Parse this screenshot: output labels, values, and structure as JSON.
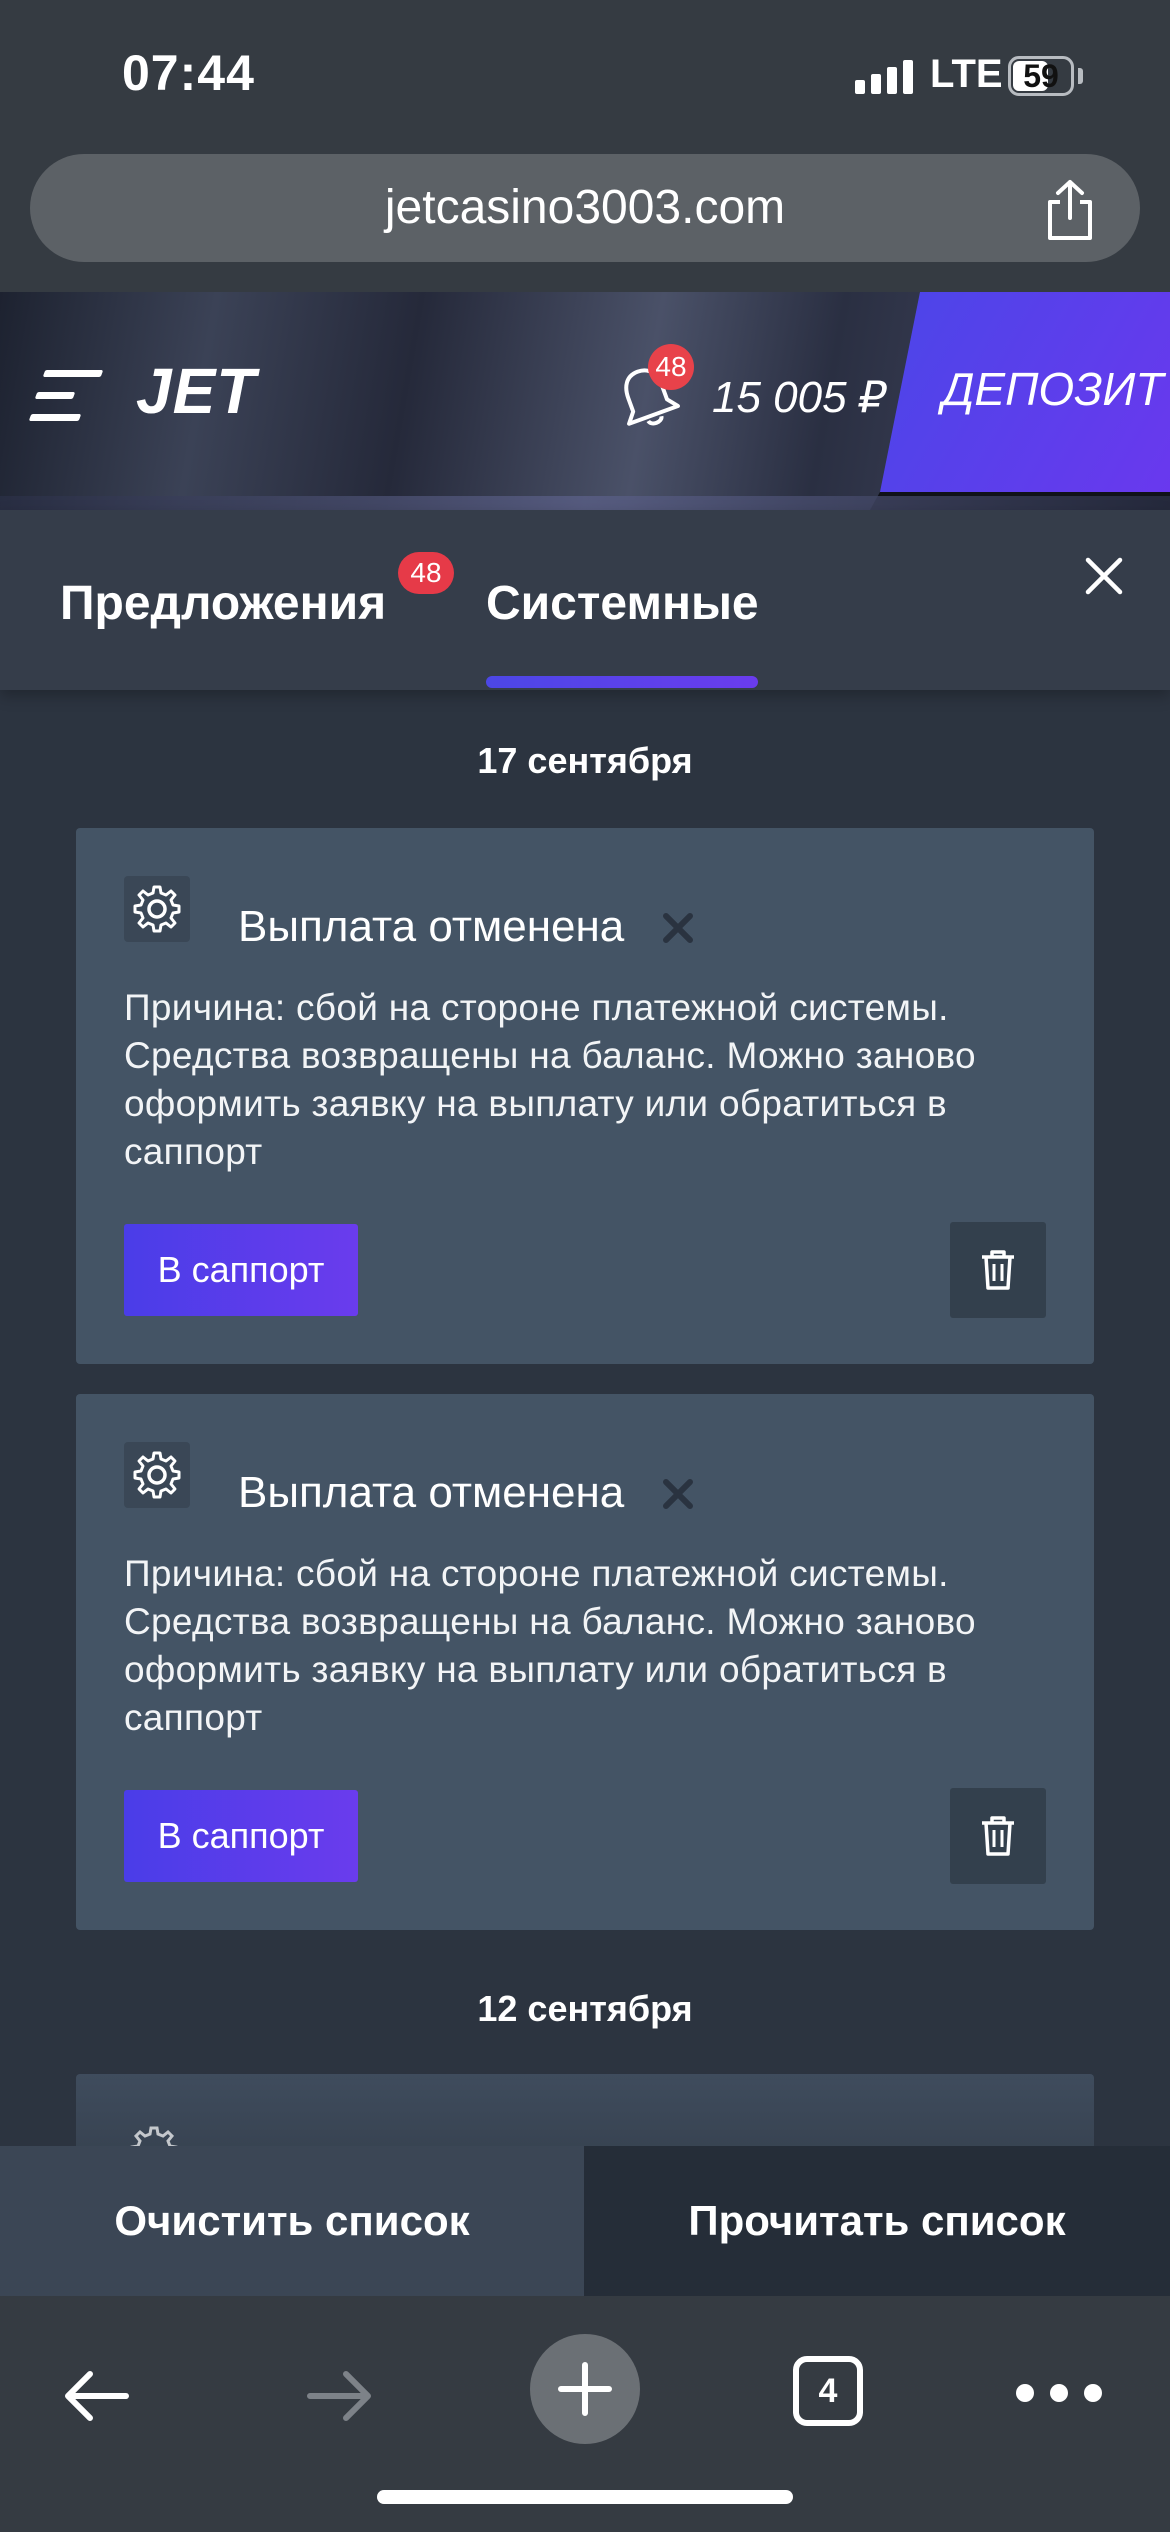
{
  "status_bar": {
    "time": "07:44",
    "network": "LTE",
    "battery": "59"
  },
  "browser": {
    "url": "jetcasino3003.com",
    "open_tabs": "4"
  },
  "header": {
    "logo": "JET",
    "notifications_count": "48",
    "balance": "15 005 ₽",
    "deposit_label": "ДЕПОЗИТ"
  },
  "tabs": [
    {
      "label": "Предложения",
      "badge": "48",
      "active": false
    },
    {
      "label": "Системные",
      "active": true
    }
  ],
  "groups": [
    {
      "date": "17 сентября",
      "cards": [
        {
          "title": "Выплата отменена",
          "body": "Причина: сбой на стороне платежной системы. Средства возвращены на баланс. Можно заново оформить заявку на выплату или обратиться в саппорт",
          "button": "В саппорт"
        },
        {
          "title": "Выплата отменена",
          "body": "Причина: сбой на стороне платежной системы. Средства возвращены на баланс. Можно заново оформить заявку на выплату или обратиться в саппорт",
          "button": "В саппорт"
        }
      ]
    },
    {
      "date": "12 сентября",
      "cards": []
    }
  ],
  "actions": {
    "clear": "Очистить список",
    "read": "Прочитать список"
  },
  "colors": {
    "accent": "#4b46e8",
    "badge": "#e63a48",
    "card_bg": "#445465",
    "page_bg": "#2c3440"
  }
}
